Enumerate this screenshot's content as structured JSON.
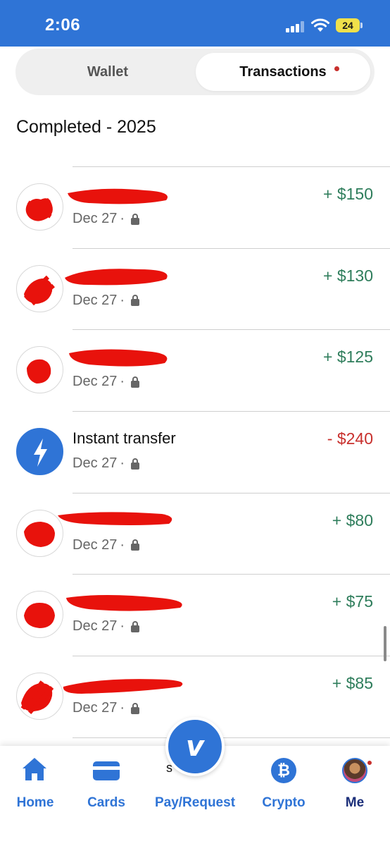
{
  "status_bar": {
    "time": "2:06",
    "battery": "24"
  },
  "tabs": {
    "wallet": "Wallet",
    "transactions": "Transactions"
  },
  "section_title": "Completed - 2025",
  "transactions": [
    {
      "name": "",
      "redacted": true,
      "date": "Dec 27",
      "amount": "+ $150",
      "type": "credit"
    },
    {
      "name": "",
      "redacted": true,
      "date": "Dec 27",
      "amount": "+ $130",
      "type": "credit"
    },
    {
      "name": "",
      "redacted": true,
      "date": "Dec 27",
      "amount": "+ $125",
      "type": "credit"
    },
    {
      "name": "Instant transfer",
      "redacted": false,
      "date": "Dec 27",
      "amount": "- $240",
      "type": "debit"
    },
    {
      "name": "",
      "redacted": true,
      "date": "Dec 27",
      "amount": "+ $80",
      "type": "credit"
    },
    {
      "name": "",
      "redacted": true,
      "date": "Dec 27",
      "amount": "+ $75",
      "type": "credit"
    },
    {
      "name": "",
      "redacted": true,
      "date": "Dec 27",
      "amount": "+ $85",
      "type": "credit"
    }
  ],
  "date_separator": "·",
  "bottom_nav": {
    "home": "Home",
    "cards": "Cards",
    "pay_request": "Pay/Request",
    "crypto": "Crypto",
    "me": "Me",
    "venmo_logo": "v",
    "crypto_glyph": "₿",
    "stray_mark": "s"
  },
  "colors": {
    "brand_blue": "#2f74d6",
    "credit_green": "#2e7d5b",
    "debit_red": "#c8302d",
    "redaction_red": "#e8120c"
  },
  "icons": {
    "signal": "signal-icon",
    "wifi": "wifi-icon",
    "battery": "battery-icon",
    "lock": "lock-icon",
    "instant": "lightning-bolt-icon",
    "home": "home-icon",
    "cards": "card-icon",
    "crypto": "crypto-coin-icon"
  }
}
